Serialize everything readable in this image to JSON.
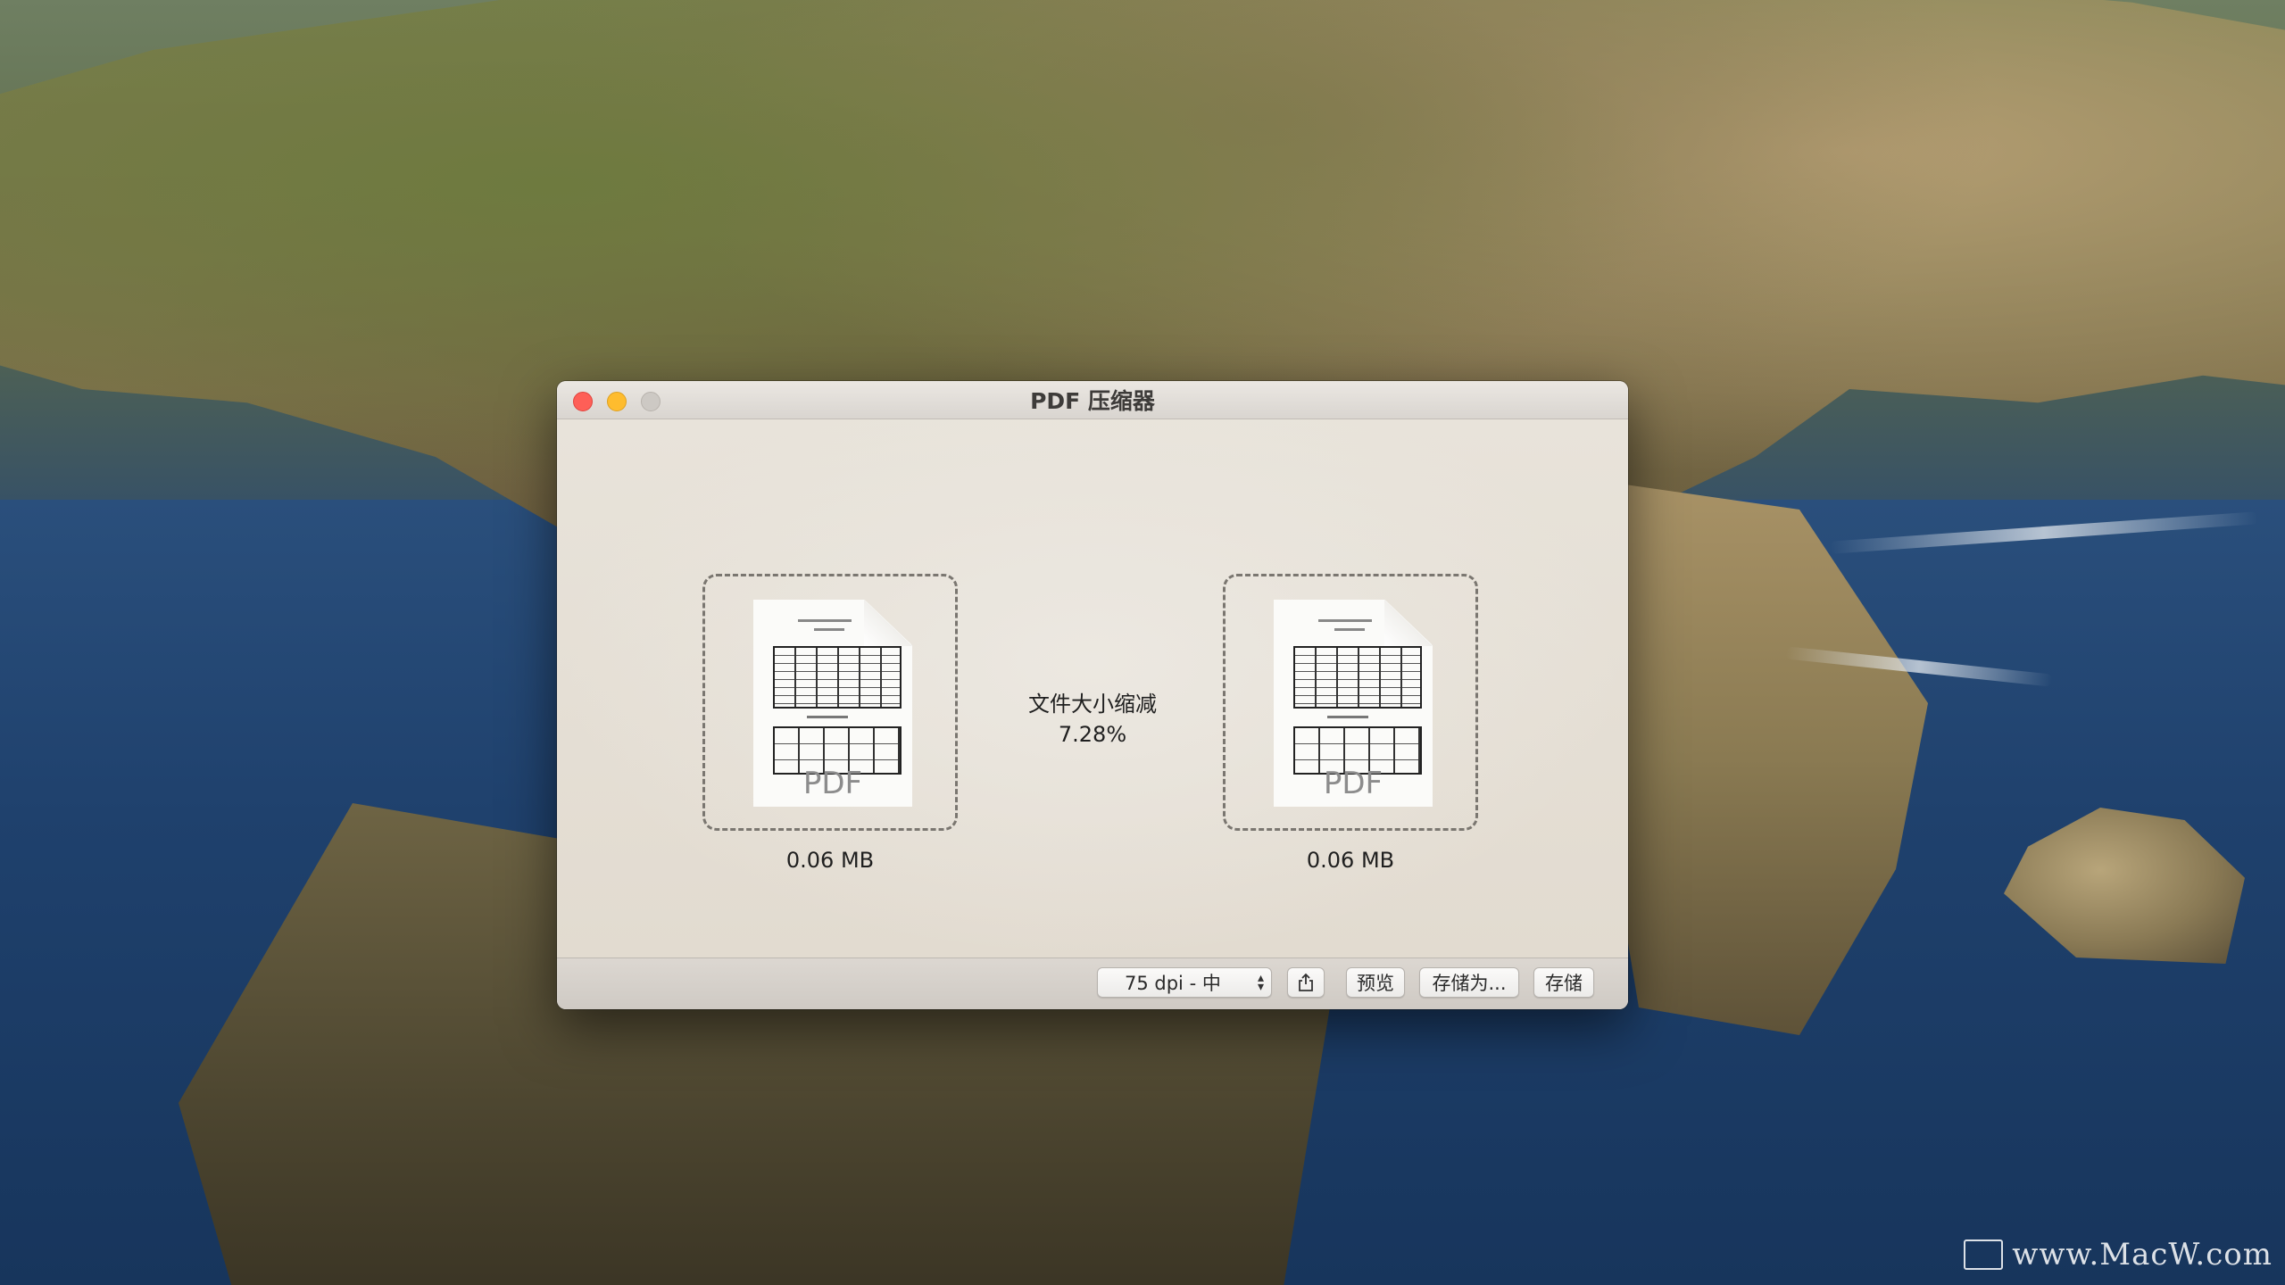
{
  "desktop": {
    "watermark": "www.MacW.com"
  },
  "window": {
    "title": "PDF 压缩器"
  },
  "original": {
    "file_label": "PDF",
    "size": "0.06 MB"
  },
  "compressed": {
    "file_label": "PDF",
    "size": "0.06 MB"
  },
  "reduction": {
    "label": "文件大小缩减",
    "percent": "7.28%"
  },
  "toolbar": {
    "quality_select": "75 dpi - 中",
    "share_icon": "share-icon",
    "preview_label": "预览",
    "save_as_label": "存储为...",
    "save_label": "存储"
  },
  "colors": {
    "close": "#fe5f57",
    "minimize": "#febc2e",
    "zoom": "#cdc9c4"
  }
}
